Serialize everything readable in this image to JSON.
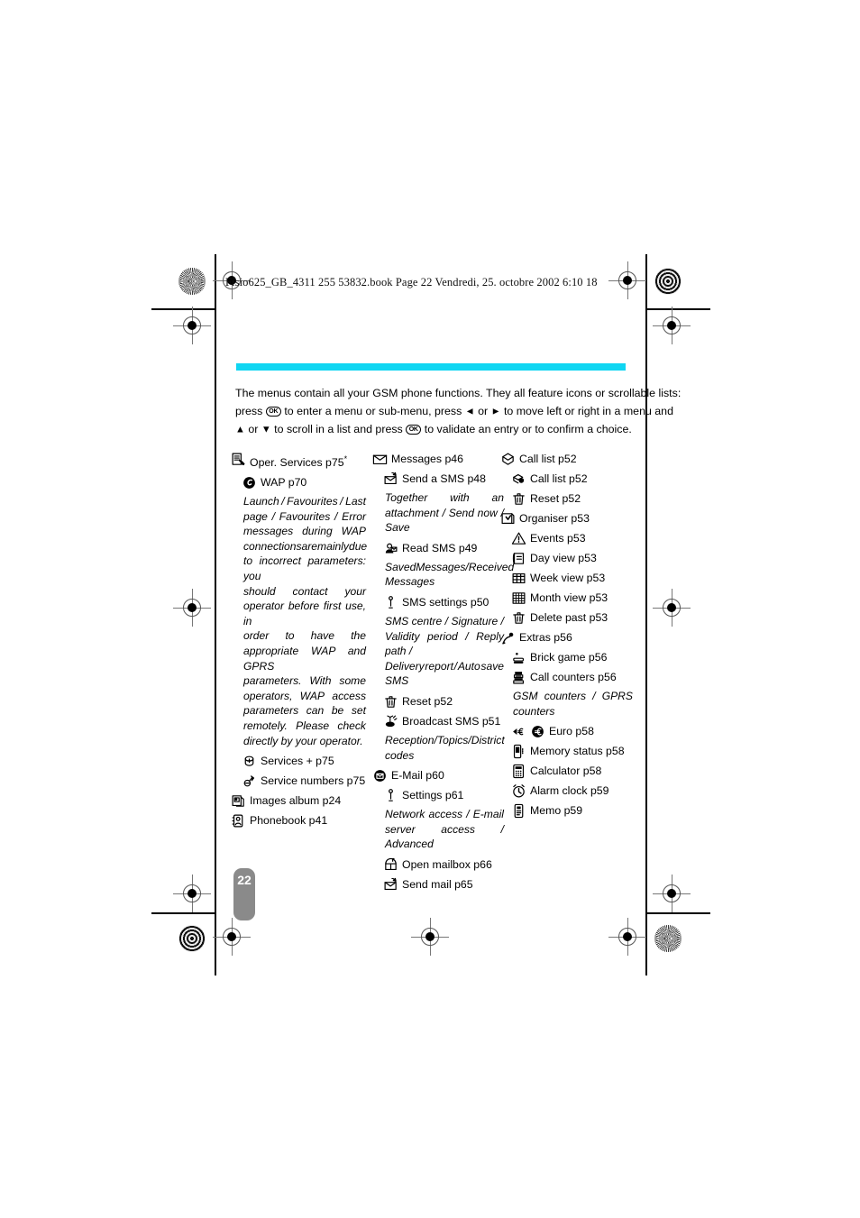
{
  "header": {
    "running_head": "Fisio625_GB_4311 255 53832.book  Page 22  Vendredi, 25. octobre 2002  6:10 18"
  },
  "page": {
    "number": "22",
    "accent_color": "#10d6f2",
    "tab_color": "#8a8a8a"
  },
  "intro": {
    "line1": "The menus contain all your GSM phone functions. They all feature icons or scrollable lists:",
    "line2_a": "press",
    "ok_key": "OK",
    "line2_b": "to enter a menu or sub-menu, press",
    "left_arrow": "◄",
    "or_1": "or",
    "right_arrow": "►",
    "line2_c": "to  move left or right in a menu and",
    "up_arrow": "▲",
    "or_2": "or",
    "down_arrow": "▼",
    "line3_a": "to scroll in a list and press",
    "line3_b": "to validate an entry or to confirm a choice."
  },
  "columns": [
    {
      "id": "column-1",
      "entries": [
        {
          "kind": "item",
          "level": 1,
          "icon": "oper-services-icon",
          "label": "Oper. Services p75",
          "suffix": "*"
        },
        {
          "kind": "item",
          "level": 2,
          "icon": "wap-icon",
          "label": "WAP p70"
        },
        {
          "kind": "note",
          "indent": 1,
          "lines": [
            [
              "Launch",
              "/",
              "Favourites",
              "/",
              "Last"
            ],
            [
              "page",
              "/",
              "Favourites",
              "/",
              "Error"
            ],
            [
              "messages",
              "during",
              "WAP"
            ],
            [
              "connections",
              "are",
              "mainly",
              "due"
            ],
            [
              "to incorrect parameters: you"
            ],
            [
              "should",
              "contact",
              "your"
            ],
            [
              "operator before first use, in"
            ],
            [
              "order",
              "to",
              "have",
              "the"
            ],
            [
              "appropriate WAP and GPRS"
            ],
            [
              "parameters.",
              "With",
              "some"
            ],
            [
              "operators,",
              "WAP",
              "access"
            ],
            [
              "parameters",
              "can",
              "be",
              "set"
            ],
            [
              "remotely.",
              "Please",
              "check"
            ],
            [
              "directly by your operator."
            ]
          ]
        },
        {
          "kind": "item",
          "level": 2,
          "icon": "services-plus-icon",
          "label": "Services + p75"
        },
        {
          "kind": "item",
          "level": 2,
          "icon": "service-numbers-icon",
          "label": "Service numbers p75"
        },
        {
          "kind": "item",
          "level": 1,
          "icon": "images-album-icon",
          "label": "Images album p24"
        },
        {
          "kind": "item",
          "level": 1,
          "icon": "phonebook-icon",
          "label": "Phonebook p41"
        }
      ]
    },
    {
      "id": "column-2",
      "entries": [
        {
          "kind": "item",
          "level": 1,
          "icon": "messages-icon",
          "label": "Messages p46"
        },
        {
          "kind": "item",
          "level": 2,
          "icon": "send-sms-icon",
          "label": "Send a SMS p48"
        },
        {
          "kind": "note",
          "indent": 1,
          "lines": [
            [
              "Together",
              "with",
              "an"
            ],
            [
              "attachment",
              "/",
              "Send",
              "now",
              "/"
            ],
            [
              "Save"
            ]
          ]
        },
        {
          "kind": "item",
          "level": 2,
          "icon": "read-sms-icon",
          "label": "Read SMS p49"
        },
        {
          "kind": "note",
          "indent": 1,
          "lines": [
            [
              "Saved",
              "Messages",
              "/",
              "Received"
            ],
            [
              "Messages"
            ]
          ]
        },
        {
          "kind": "item",
          "level": 2,
          "icon": "sms-settings-icon",
          "label": "SMS settings p50"
        },
        {
          "kind": "note",
          "indent": 1,
          "lines": [
            [
              "SMS",
              "centre",
              "/",
              "Signature",
              "/"
            ],
            [
              "Validity period / Reply path /"
            ],
            [
              "Delivery",
              "report",
              "/",
              "Auto",
              "save"
            ],
            [
              "SMS"
            ]
          ]
        },
        {
          "kind": "item",
          "level": 2,
          "icon": "reset-trash-icon",
          "label": "Reset p52"
        },
        {
          "kind": "item",
          "level": 2,
          "icon": "broadcast-sms-icon",
          "label": "Broadcast SMS p51"
        },
        {
          "kind": "note",
          "indent": 1,
          "lines": [
            [
              "Reception",
              "/",
              "Topics",
              "/",
              "District"
            ],
            [
              "codes"
            ]
          ]
        },
        {
          "kind": "item",
          "level": 1,
          "icon": "email-icon",
          "label": "E-Mail p60"
        },
        {
          "kind": "item",
          "level": 2,
          "icon": "settings-icon",
          "label": "Settings p61"
        },
        {
          "kind": "note",
          "indent": 1,
          "lines": [
            [
              "Network",
              "access",
              "/",
              "E-mail"
            ],
            [
              "server access / Advanced"
            ]
          ]
        },
        {
          "kind": "item",
          "level": 2,
          "icon": "open-mailbox-icon",
          "label": "Open mailbox p66"
        },
        {
          "kind": "item",
          "level": 2,
          "icon": "send-mail-icon",
          "label": "Send mail p65"
        }
      ]
    },
    {
      "id": "column-3",
      "entries": [
        {
          "kind": "item",
          "level": 1,
          "icon": "call-list-icon",
          "label": "Call list p52"
        },
        {
          "kind": "item",
          "level": 2,
          "icon": "call-list-sub-icon",
          "label": "Call list p52"
        },
        {
          "kind": "item",
          "level": 2,
          "icon": "reset-trash-icon",
          "label": "Reset p52"
        },
        {
          "kind": "item",
          "level": 1,
          "icon": "organiser-icon",
          "label": "Organiser p53"
        },
        {
          "kind": "item",
          "level": 2,
          "icon": "events-icon",
          "label": "Events p53"
        },
        {
          "kind": "item",
          "level": 2,
          "icon": "day-view-icon",
          "label": "Day view p53"
        },
        {
          "kind": "item",
          "level": 2,
          "icon": "week-view-icon",
          "label": "Week view p53"
        },
        {
          "kind": "item",
          "level": 2,
          "icon": "month-view-icon",
          "label": "Month view p53"
        },
        {
          "kind": "item",
          "level": 2,
          "icon": "reset-trash-icon",
          "label": "Delete past p53"
        },
        {
          "kind": "item",
          "level": 1,
          "icon": "extras-icon",
          "label": "Extras p56"
        },
        {
          "kind": "item",
          "level": 2,
          "icon": "brick-game-icon",
          "label": "Brick game p56"
        },
        {
          "kind": "item",
          "level": 2,
          "icon": "call-counters-icon",
          "label": "Call counters p56"
        },
        {
          "kind": "note",
          "indent": 1,
          "lines": [
            [
              "GSM",
              "counters",
              "/",
              "GPRS"
            ],
            [
              "counters"
            ]
          ]
        },
        {
          "kind": "item",
          "level": 2,
          "icon": "euro-converter-icon",
          "icon2": "euro-icon",
          "label": "Euro p58"
        },
        {
          "kind": "item",
          "level": 2,
          "icon": "memory-status-icon",
          "label": "Memory status p58"
        },
        {
          "kind": "item",
          "level": 2,
          "icon": "calculator-icon",
          "label": "Calculator p58"
        },
        {
          "kind": "item",
          "level": 2,
          "icon": "alarm-clock-icon",
          "label": "Alarm clock p59"
        },
        {
          "kind": "item",
          "level": 2,
          "icon": "memo-icon",
          "label": "Memo p59"
        }
      ]
    }
  ]
}
